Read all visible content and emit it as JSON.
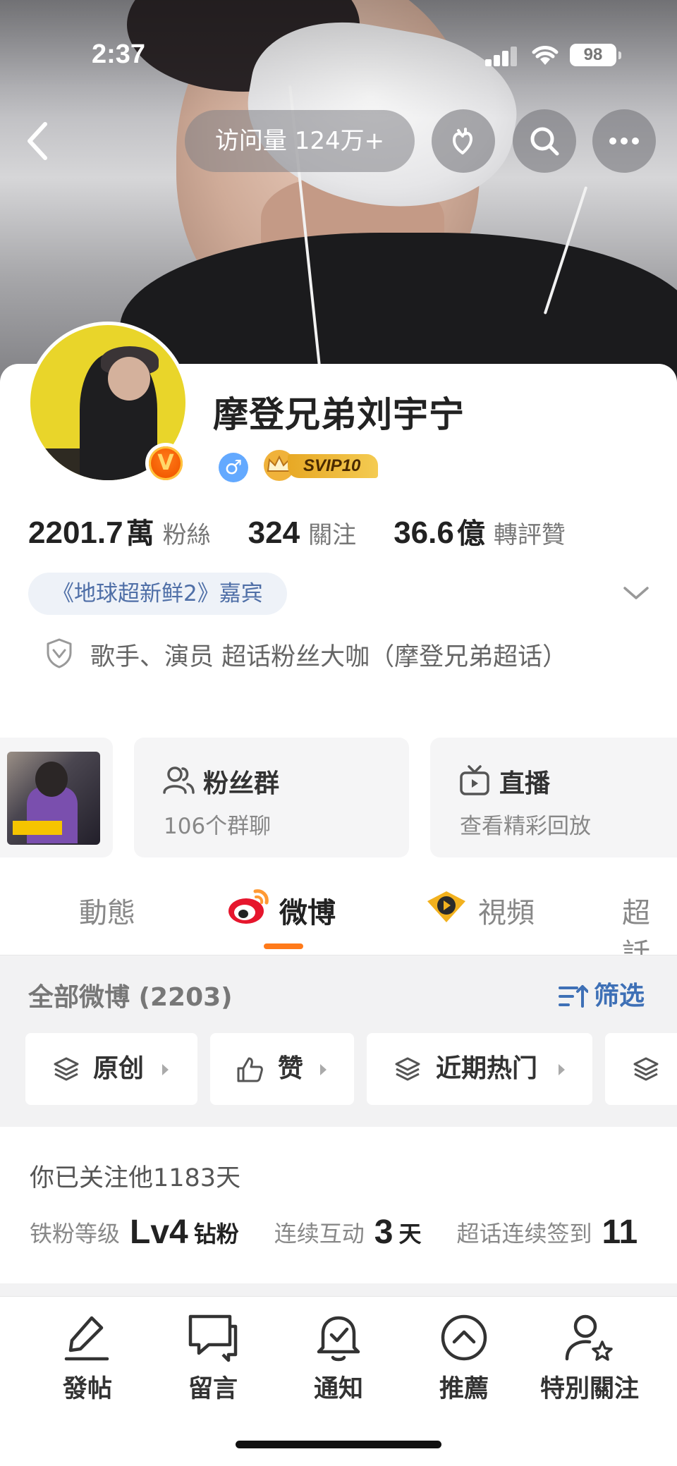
{
  "status_bar": {
    "time": "2:37",
    "battery": "98"
  },
  "top_nav": {
    "visits": "访问量 124万+"
  },
  "profile": {
    "name": "摩登兄弟刘宇宁",
    "gender_symbol": "♂",
    "svip": "SVIP10",
    "verified_symbol": "V",
    "stats": [
      {
        "num": "2201.7",
        "unit": "萬",
        "label": "粉絲"
      },
      {
        "num": "324",
        "unit": "",
        "label": "關注"
      },
      {
        "num": "36.6",
        "unit": "億",
        "label": "轉評贊"
      }
    ],
    "guest_tag": "《地球超新鲜2》嘉宾",
    "description": "歌手、演员 超话粉丝大咖（摩登兄弟超话）"
  },
  "cards": {
    "fans_group": {
      "title": "粉丝群",
      "subtitle": "106个群聊"
    },
    "live": {
      "title": "直播",
      "subtitle": "查看精彩回放"
    }
  },
  "tabs": [
    {
      "label": "動態"
    },
    {
      "label": "微博",
      "active": true
    },
    {
      "label": "視頻"
    },
    {
      "label": "超話"
    }
  ],
  "feed": {
    "title": "全部微博 (2203)",
    "filter_label": "筛选",
    "chips": [
      {
        "label": "原创"
      },
      {
        "label": "赞"
      },
      {
        "label": "近期热门"
      }
    ]
  },
  "follow_info": {
    "days_text": "你已关注他1183天",
    "items": [
      {
        "label": "铁粉等级",
        "value": "Lv4",
        "unit": "钻粉"
      },
      {
        "label": "连续互动",
        "value": "3",
        "unit": "天"
      },
      {
        "label": "超话连续签到",
        "value": "11",
        "unit": ""
      }
    ]
  },
  "bottom_bar": [
    {
      "label": "發帖",
      "icon": "pencil-icon"
    },
    {
      "label": "留言",
      "icon": "message-icon"
    },
    {
      "label": "通知",
      "icon": "bell-icon"
    },
    {
      "label": "推薦",
      "icon": "up-circle-icon"
    },
    {
      "label": "特別關注",
      "icon": "user-star-icon"
    }
  ],
  "colors": {
    "accent": "#ff7a1a",
    "link_blue": "#3e70b6",
    "verified_orange": "#f25a00",
    "svip_gold": "#e7a825"
  }
}
